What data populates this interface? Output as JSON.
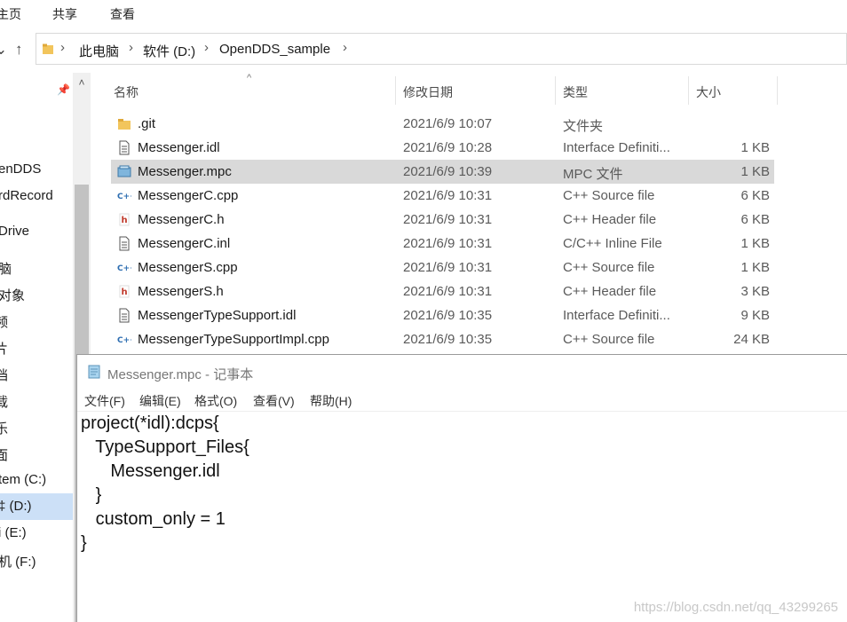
{
  "ribbon": {
    "tabs": [
      "主页",
      "共享",
      "查看"
    ]
  },
  "address": {
    "crumbs": [
      "此电脑",
      "软件 (D:)",
      "OpenDDS_sample"
    ]
  },
  "sidebar": {
    "items": [
      "enDDS",
      "rdRecord",
      "Drive",
      "脑",
      "对象",
      "频",
      "片",
      "档",
      "载",
      "乐",
      "面",
      "tem (C:)",
      "‡ (D:)",
      "i (E:)",
      "机 (F:)"
    ]
  },
  "columns": {
    "name": "名称",
    "date": "修改日期",
    "type": "类型",
    "size": "大小"
  },
  "files": [
    {
      "name": ".git",
      "date": "2021/6/9 10:07",
      "type": "文件夹",
      "size": "",
      "icon": "folder-icon"
    },
    {
      "name": "Messenger.idl",
      "date": "2021/6/9 10:28",
      "type": "Interface Definiti...",
      "size": "1 KB",
      "icon": "text-file-icon"
    },
    {
      "name": "Messenger.mpc",
      "date": "2021/6/9 10:39",
      "type": "MPC 文件",
      "size": "1 KB",
      "icon": "notepad-file-icon"
    },
    {
      "name": "MessengerC.cpp",
      "date": "2021/6/9 10:31",
      "type": "C++ Source file",
      "size": "6 KB",
      "icon": "cpp-file-icon"
    },
    {
      "name": "MessengerC.h",
      "date": "2021/6/9 10:31",
      "type": "C++ Header file",
      "size": "6 KB",
      "icon": "header-file-icon"
    },
    {
      "name": "MessengerC.inl",
      "date": "2021/6/9 10:31",
      "type": "C/C++ Inline File",
      "size": "1 KB",
      "icon": "text-file-icon"
    },
    {
      "name": "MessengerS.cpp",
      "date": "2021/6/9 10:31",
      "type": "C++ Source file",
      "size": "1 KB",
      "icon": "cpp-file-icon"
    },
    {
      "name": "MessengerS.h",
      "date": "2021/6/9 10:31",
      "type": "C++ Header file",
      "size": "3 KB",
      "icon": "header-file-icon"
    },
    {
      "name": "MessengerTypeSupport.idl",
      "date": "2021/6/9 10:35",
      "type": "Interface Definiti...",
      "size": "9 KB",
      "icon": "text-file-icon"
    },
    {
      "name": "MessengerTypeSupportImpl.cpp",
      "date": "2021/6/9 10:35",
      "type": "C++ Source file",
      "size": "24 KB",
      "icon": "cpp-file-icon"
    }
  ],
  "selected_file": "Messenger.mpc",
  "notepad": {
    "title": "Messenger.mpc - 记事本",
    "menu": [
      "文件(F)",
      "编辑(E)",
      "格式(O)",
      "查看(V)",
      "帮助(H)"
    ],
    "lines": [
      "project(*idl):dcps{",
      "   TypeSupport_Files{",
      "      Messenger.idl",
      "   }",
      "   custom_only = 1",
      "}"
    ]
  },
  "watermark": "https://blog.csdn.net/qq_43299265",
  "colors": {
    "selection_row": "#d9d9d9",
    "sidebar_selected": "#cce0f7",
    "folder": "#f2c55c",
    "cpp_blue": "#2b6cb0",
    "header_red": "#c0392b"
  }
}
